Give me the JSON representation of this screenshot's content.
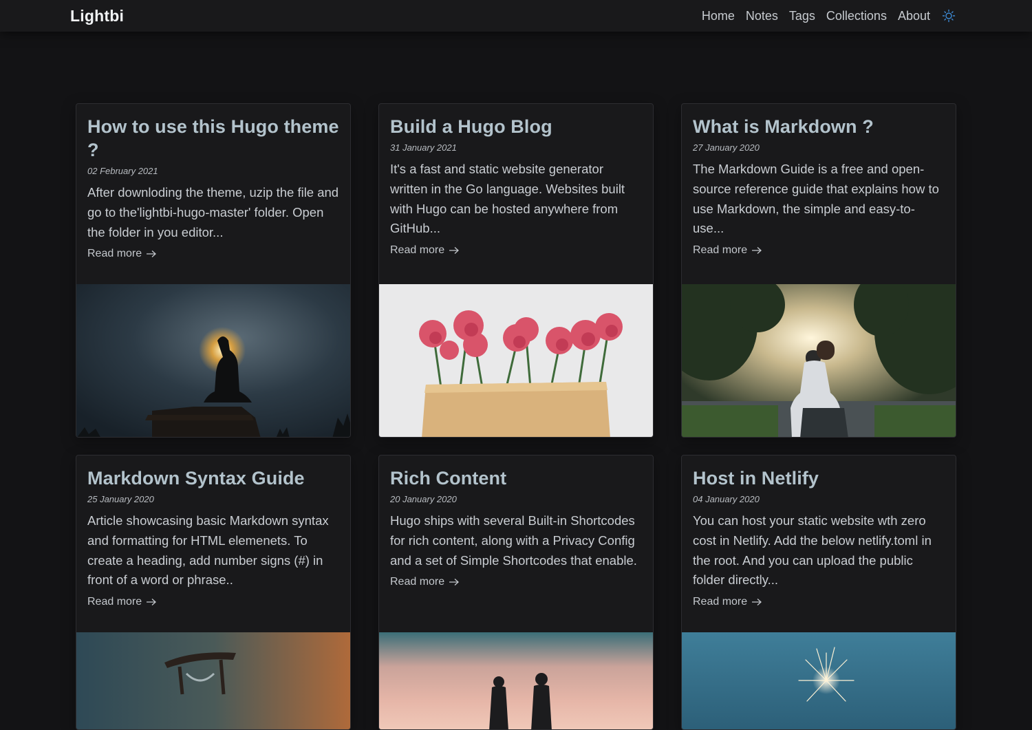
{
  "navbar": {
    "brand": "Lightbi",
    "links": [
      "Home",
      "Notes",
      "Tags",
      "Collections",
      "About"
    ],
    "theme_icon": "sun-icon",
    "accent_color": "#3d8bd6"
  },
  "cards": [
    {
      "title": "How to use this Hugo theme ?",
      "date": "02 February 2021",
      "excerpt": "After downloding the theme, uzip the file and go to the'lightbi-hugo-master' folder. Open the folder in you editor...",
      "read_more": "Read more",
      "image": "silhouette-statue-at-sun"
    },
    {
      "title": "Build a Hugo Blog",
      "date": "31 January 2021",
      "excerpt": "It's a fast and static website generator written in the Go language. Websites built with Hugo can be hosted anywhere from GitHub...",
      "read_more": "Read more",
      "image": "pink-carnations-envelope"
    },
    {
      "title": "What is Markdown ?",
      "date": "27 January 2020",
      "excerpt": "The Markdown Guide is a free and open-source reference guide that explains how to use Markdown, the simple and easy-to-use...",
      "read_more": "Read more",
      "image": "man-sitting-in-park"
    },
    {
      "title": "Markdown Syntax Guide",
      "date": "25 January 2020",
      "excerpt": "Article showcasing basic Markdown syntax and formatting for HTML elemenets. To create a heading, add number signs (#) in front of a word or phrase..",
      "read_more": "Read more",
      "image": "hourglass"
    },
    {
      "title": "Rich Content",
      "date": "20 January 2020",
      "excerpt": "Hugo ships with several Built-in Shortcodes for rich content, along with a Privacy Config and a set of Simple Shortcodes that enable.",
      "read_more": "Read more",
      "image": "two-people-at-sunset"
    },
    {
      "title": "Host in Netlify",
      "date": "04 January 2020",
      "excerpt": "You can host your static website wth zero cost in Netlify. Add the below netlify.toml in the root. And you can upload the public folder directly...",
      "read_more": "Read more",
      "image": "sparkler"
    }
  ]
}
